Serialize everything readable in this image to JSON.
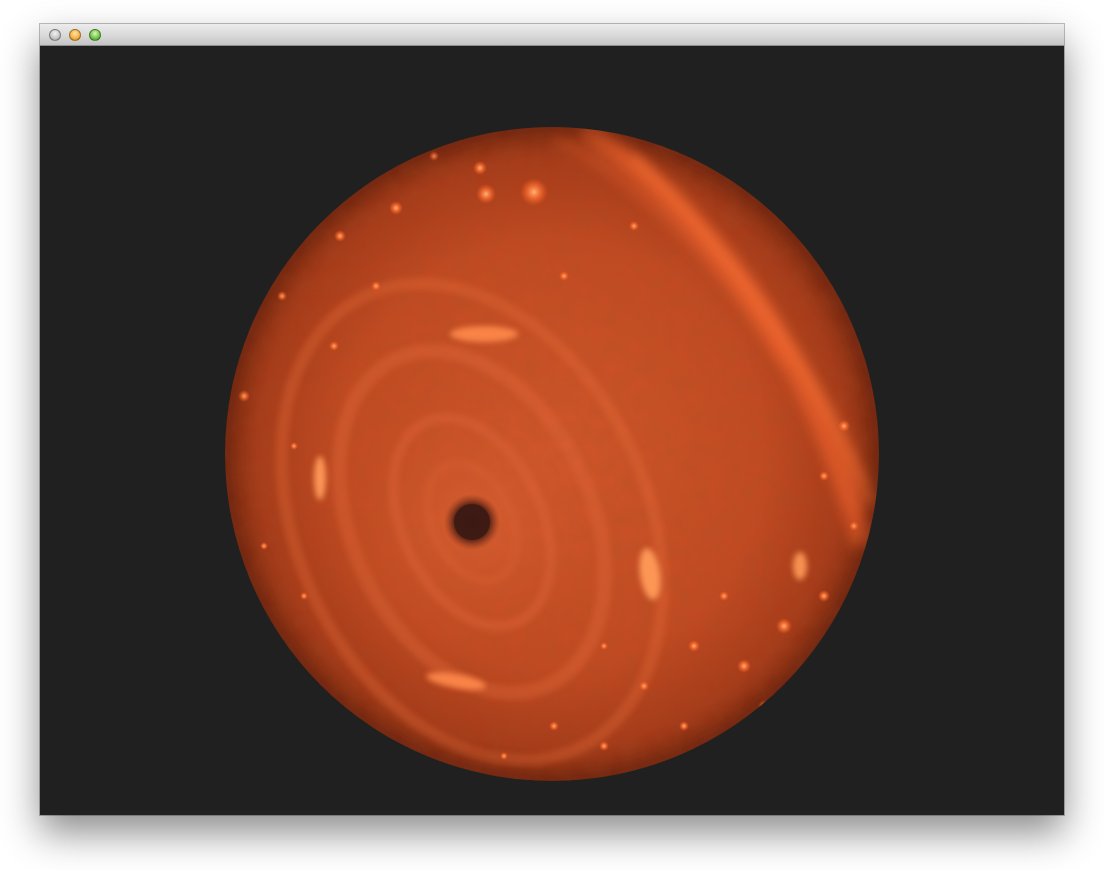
{
  "window": {
    "title": "",
    "controls": [
      "close",
      "minimize",
      "zoom"
    ]
  },
  "viewport": {
    "background_color": "#202020"
  },
  "render": {
    "subject": "planet",
    "base_color": "#c8481f",
    "highlight_color": "#ff7a3a",
    "shadow_color": "#5a1a0a",
    "spot_color": "#3a1a14"
  }
}
